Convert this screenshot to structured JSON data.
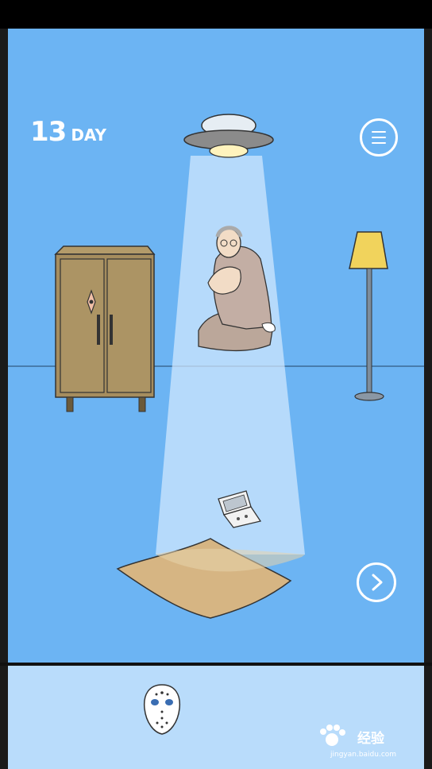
{
  "hud": {
    "day_number": "13",
    "day_label": "DAY"
  },
  "icons": {
    "menu": "hamburger-menu-icon",
    "next": "chevron-right-icon"
  },
  "scene": {
    "objects": [
      "ufo",
      "tractor-beam",
      "old-man",
      "wardrobe",
      "floor-lamp",
      "game-console",
      "cushion"
    ]
  },
  "inventory": {
    "items": [
      {
        "name": "hockey-mask"
      }
    ]
  },
  "watermark": {
    "brand": "经验",
    "url": "jingyan.baidu.com"
  },
  "colors": {
    "sky": "#6cb4f3",
    "inventory_bg": "#b9dcfb",
    "beam": "#cfe6fb",
    "wardrobe": "#a68d5e",
    "cushion": "#d6b583",
    "lamp_shade": "#f1d35c"
  }
}
